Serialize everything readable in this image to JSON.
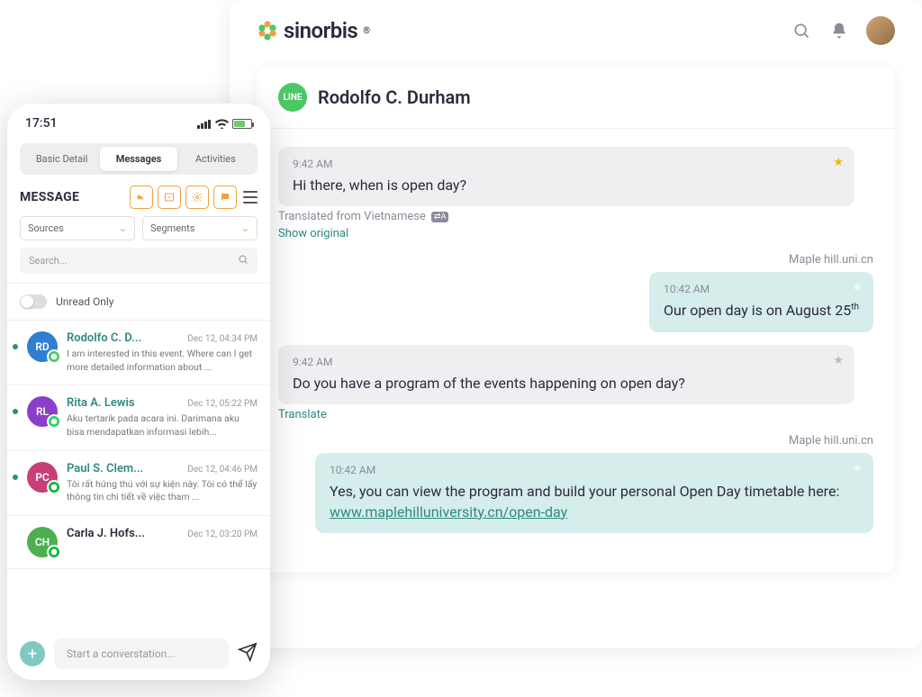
{
  "brand": "sinorbis",
  "chat": {
    "contact_name": "Rodolfo C. Durham",
    "line_badge": "LINE",
    "messages": [
      {
        "side": "left",
        "ts": "9:42 AM",
        "body": "Hi there, when is open day?",
        "style": "grey",
        "star": "gold",
        "translated": "Translated from Vietnamese",
        "show_original": "Show original"
      },
      {
        "side": "right",
        "sender": "Maple hill.uni.cn",
        "ts": "10:42 AM",
        "body_pre": "Our open day is on August 25",
        "ord": "th",
        "style": "teal",
        "star": "white"
      },
      {
        "side": "left",
        "ts": "9:42 AM",
        "body": "Do you have a program of the events happening on open day?",
        "style": "grey",
        "star": "dim",
        "translate_link": "Translate"
      },
      {
        "side": "right",
        "sender": "Maple hill.uni.cn",
        "ts": "10:42 AM",
        "body_pre": "Yes, you can view the program and build your personal Open Day timetable here: ",
        "link": "www.maplehilluniversity.cn/open-day",
        "style": "teal",
        "star": "white",
        "wide": true
      }
    ]
  },
  "mobile": {
    "time": "17:51",
    "tabs": {
      "basic": "Basic Detail",
      "messages": "Messages",
      "activities": "Activities"
    },
    "heading": "MESSAGE",
    "filters": {
      "sources": "Sources",
      "segments": "Segments"
    },
    "search_placeholder": "Search...",
    "unread_label": "Unread Only",
    "conversations": [
      {
        "initials": "RD",
        "badge": "line",
        "badge_color": "#4cc764",
        "thumb_color": "#2f7fd1",
        "name": "Rodolfo C. D...",
        "date": "Dec 12, 04:34 PM",
        "preview": "I am interested in this event. Where can I get more detailed information about ...",
        "unread": true
      },
      {
        "initials": "RL",
        "badge": "whatsapp",
        "badge_color": "#25d366",
        "thumb_color": "#8b3fc9",
        "name": "Rita A. Lewis",
        "date": "Dec 12, 05:22 PM",
        "preview": "Aku tertarik pada acara ini. Darimana aku bisa mendapatkan informasi lebih...",
        "unread": true
      },
      {
        "initials": "PC",
        "badge": "wechat",
        "badge_color": "#09b83e",
        "thumb_color": "#c73f76",
        "name": "Paul S. Clem...",
        "date": "Dec 12, 04:46 PM",
        "preview": "Tôi rất hứng thú với sự kiện này. Tôi có thể lấy thông tin chi tiết về việc tham ...",
        "unread": true
      },
      {
        "initials": "CH",
        "badge": "wechat",
        "badge_color": "#09b83e",
        "thumb_color": "#4caf50",
        "name": "Carla J. Hofs...",
        "date": "Dec 12, 03:20 PM",
        "preview": "",
        "unread": false,
        "dark": true
      }
    ],
    "compose_placeholder": "Start a converstation..."
  }
}
